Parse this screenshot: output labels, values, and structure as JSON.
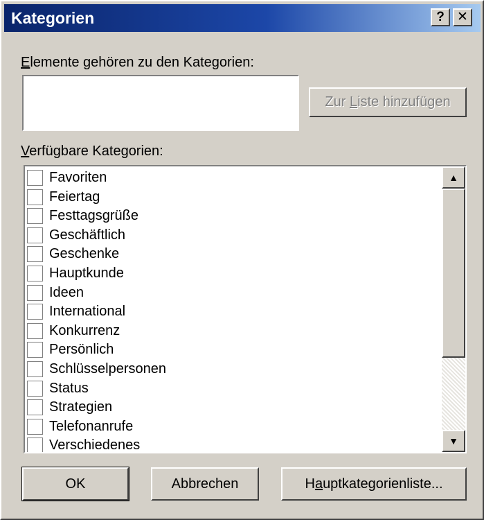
{
  "window": {
    "title": "Kategorien",
    "help_glyph": "?",
    "close_glyph": "✕"
  },
  "assigned": {
    "label_accesskey": "E",
    "label_rest": "lemente gehören zu den Kategorien:",
    "value": ""
  },
  "add_button": {
    "accesskey": "L",
    "prefix": "Zur ",
    "suffix": "iste hinzufügen"
  },
  "available": {
    "label_accesskey": "V",
    "label_rest": "erfügbare Kategorien:",
    "items": [
      {
        "label": "Favoriten",
        "checked": false
      },
      {
        "label": "Feiertag",
        "checked": false
      },
      {
        "label": "Festtagsgrüße",
        "checked": false
      },
      {
        "label": "Geschäftlich",
        "checked": false
      },
      {
        "label": "Geschenke",
        "checked": false
      },
      {
        "label": "Hauptkunde",
        "checked": false
      },
      {
        "label": "Ideen",
        "checked": false
      },
      {
        "label": "International",
        "checked": false
      },
      {
        "label": "Konkurrenz",
        "checked": false
      },
      {
        "label": "Persönlich",
        "checked": false
      },
      {
        "label": "Schlüsselpersonen",
        "checked": false
      },
      {
        "label": "Status",
        "checked": false
      },
      {
        "label": "Strategien",
        "checked": false
      },
      {
        "label": "Telefonanrufe",
        "checked": false
      },
      {
        "label": "Verschiedenes",
        "checked": false
      }
    ]
  },
  "scrollbar": {
    "up_icon": "▲",
    "down_icon": "▼"
  },
  "buttons": {
    "ok": "OK",
    "cancel": "Abbrechen",
    "master_prefix": "H",
    "master_accesskey": "a",
    "master_suffix": "uptkategorienliste..."
  },
  "colors": {
    "title_gradient_start": "#0a246a",
    "title_gradient_end": "#a6caf0",
    "face": "#d4d0c8"
  }
}
